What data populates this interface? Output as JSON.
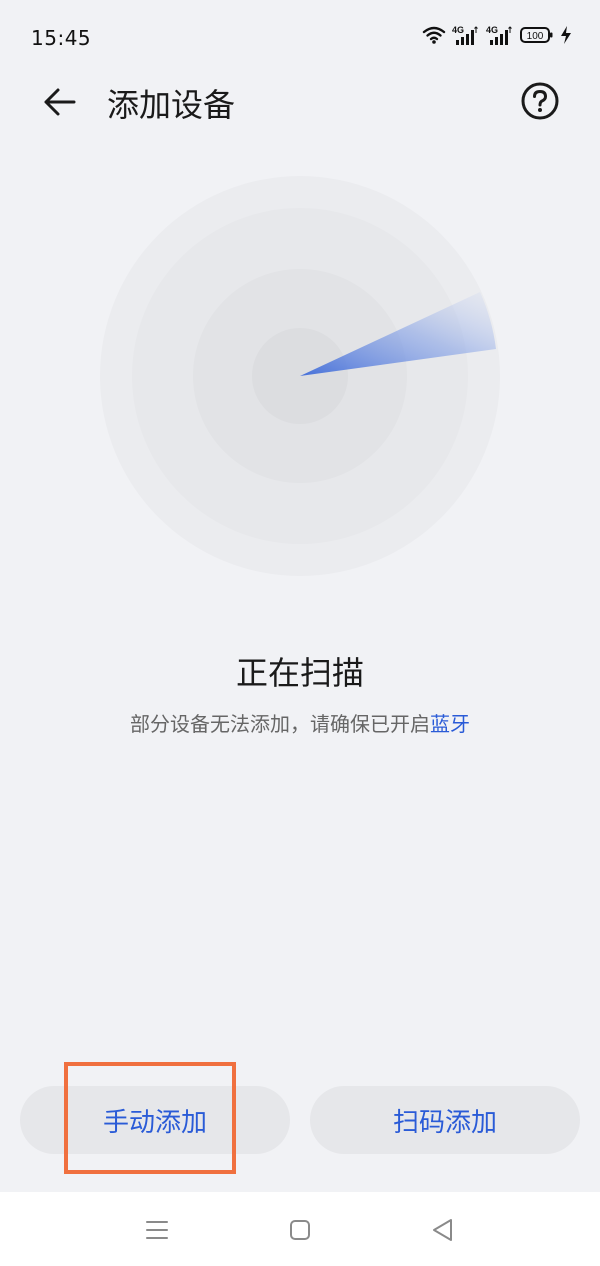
{
  "status_bar": {
    "time": "15:45",
    "battery": "100",
    "network_1": "4G",
    "network_2": "4G",
    "icons": [
      "wifi-icon",
      "signal-4g-icon",
      "signal-4g-icon",
      "battery-icon",
      "charging-icon"
    ]
  },
  "header": {
    "title": "添加设备",
    "back_icon": "back-arrow-icon",
    "help_icon": "help-icon"
  },
  "scan": {
    "title": "正在扫描",
    "hint_text": "部分设备无法添加，请确保已开启",
    "hint_link": "蓝牙"
  },
  "actions": {
    "manual_add": "手动添加",
    "scan_code_add": "扫码添加"
  },
  "nav": {
    "icons": [
      "menu-icon",
      "home-icon",
      "back-icon"
    ]
  },
  "colors": {
    "accent": "#2a5bd7",
    "background": "#f1f2f5",
    "button_bg": "#e6e7ea",
    "highlight": "#f0703f"
  }
}
